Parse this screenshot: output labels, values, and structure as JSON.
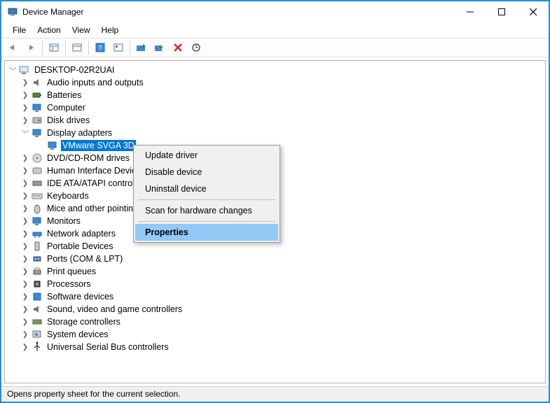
{
  "window": {
    "title": "Device Manager"
  },
  "menu": {
    "file": "File",
    "action": "Action",
    "view": "View",
    "help": "Help"
  },
  "tree": {
    "root": "DESKTOP-02R2UAI",
    "items": [
      "Audio inputs and outputs",
      "Batteries",
      "Computer",
      "Disk drives",
      "Display adapters",
      "VMware SVGA 3D",
      "DVD/CD-ROM drives",
      "Human Interface Devices",
      "IDE ATA/ATAPI controllers",
      "Keyboards",
      "Mice and other pointing devices",
      "Monitors",
      "Network adapters",
      "Portable Devices",
      "Ports (COM & LPT)",
      "Print queues",
      "Processors",
      "Software devices",
      "Sound, video and game controllers",
      "Storage controllers",
      "System devices",
      "Universal Serial Bus controllers"
    ]
  },
  "context": {
    "update": "Update driver",
    "disable": "Disable device",
    "uninstall": "Uninstall device",
    "scan": "Scan for hardware changes",
    "properties": "Properties"
  },
  "status": {
    "text": "Opens property sheet for the current selection."
  },
  "colors": {
    "accent": "#0078d7",
    "highlight": "#91c9f7"
  }
}
